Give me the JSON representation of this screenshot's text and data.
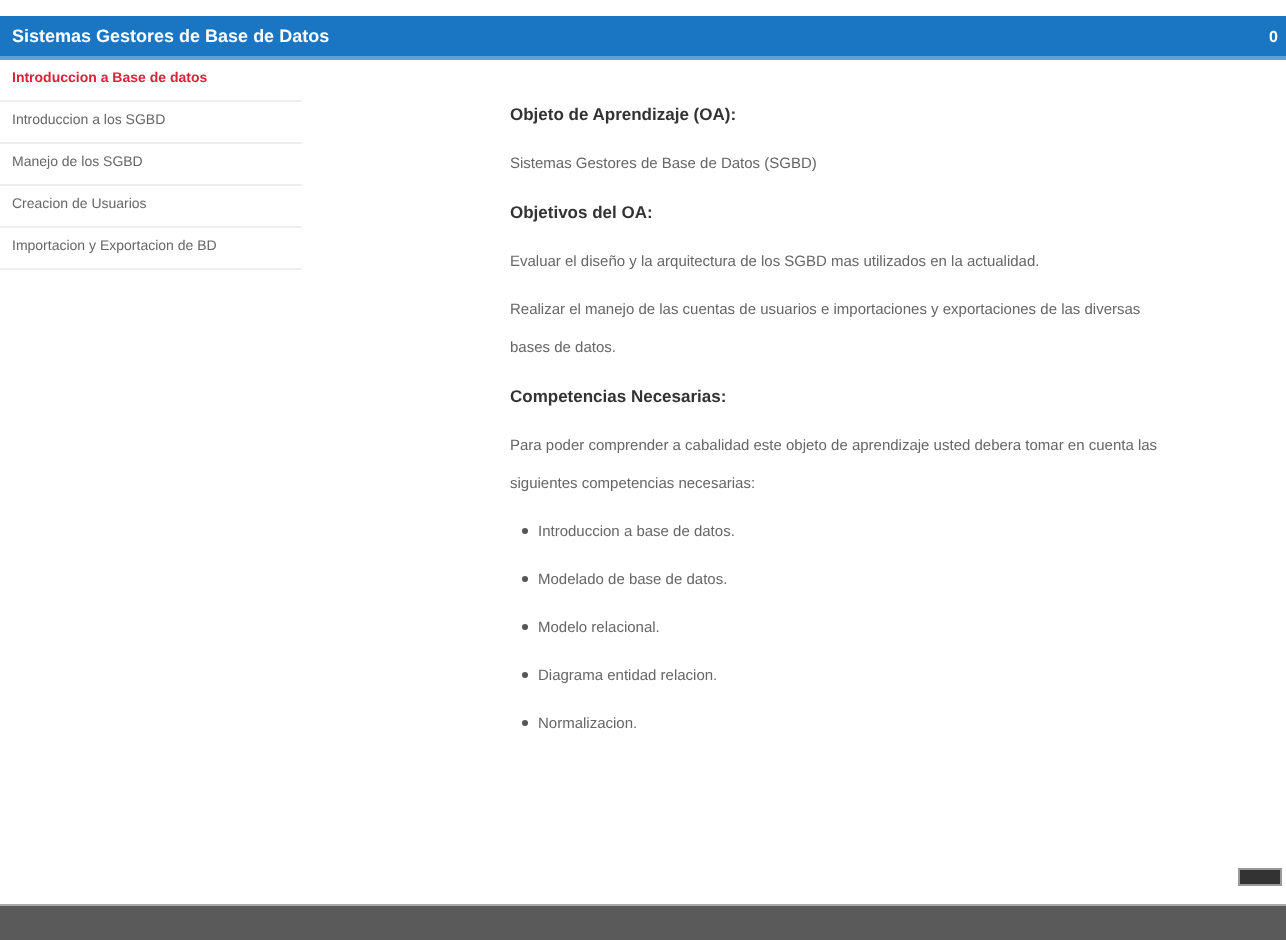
{
  "header": {
    "title": "Sistemas Gestores de Base de Datos",
    "right_text": "0"
  },
  "sidebar": {
    "items": [
      {
        "label": "Introduccion a Base de datos",
        "selected": true
      },
      {
        "label": "Introduccion a los SGBD",
        "selected": false
      },
      {
        "label": "Manejo de los SGBD",
        "selected": false
      },
      {
        "label": "Creacion de Usuarios",
        "selected": false
      },
      {
        "label": "Importacion y Exportacion de BD",
        "selected": false
      }
    ]
  },
  "content": [
    {
      "kind": "heading",
      "text": "Objeto de Aprendizaje (OA):"
    },
    {
      "kind": "paragraph",
      "text": "Sistemas Gestores de Base de Datos (SGBD)"
    },
    {
      "kind": "heading",
      "text": "Objetivos del OA:"
    },
    {
      "kind": "paragraph",
      "text": "Evaluar el diseño y la arquitectura de los SGBD mas utilizados en la actualidad."
    },
    {
      "kind": "paragraph",
      "text": "Realizar el manejo de las cuentas de usuarios e importaciones y exportaciones de las diversas bases de datos."
    },
    {
      "kind": "heading",
      "text": "Competencias Necesarias:"
    },
    {
      "kind": "paragraph",
      "text": "Para poder comprender a cabalidad este objeto de aprendizaje usted debera tomar en cuenta las siguientes competencias necesarias:"
    },
    {
      "kind": "bullet",
      "text": "Introduccion a base de datos."
    },
    {
      "kind": "bullet",
      "text": "Modelado de base de datos."
    },
    {
      "kind": "bullet",
      "text": "Modelo relacional."
    },
    {
      "kind": "bullet",
      "text": "Diagrama entidad relacion."
    },
    {
      "kind": "bullet",
      "text": "Normalizacion."
    }
  ]
}
